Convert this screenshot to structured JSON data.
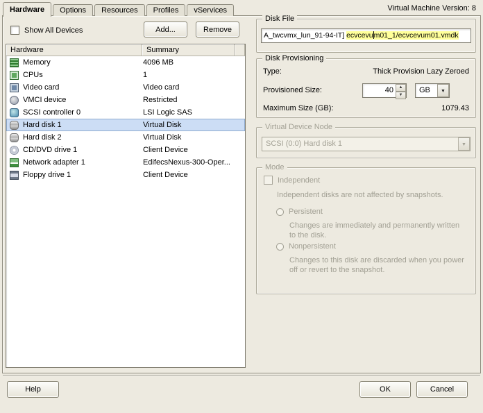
{
  "window": {
    "version_label": "Virtual Machine Version: 8"
  },
  "tabs": [
    {
      "label": "Hardware",
      "active": true
    },
    {
      "label": "Options"
    },
    {
      "label": "Resources"
    },
    {
      "label": "Profiles"
    },
    {
      "label": "vServices"
    }
  ],
  "left_panel": {
    "show_all_devices_label": "Show All Devices",
    "show_all_devices_checked": false,
    "add_button": "Add...",
    "remove_button": "Remove",
    "table": {
      "headers": [
        "Hardware",
        "Summary"
      ],
      "rows": [
        {
          "icon": "memory-icon",
          "hardware": "Memory",
          "summary": "4096 MB"
        },
        {
          "icon": "cpu-icon",
          "hardware": "CPUs",
          "summary": "1"
        },
        {
          "icon": "video-card-icon",
          "hardware": "Video card",
          "summary": "Video card"
        },
        {
          "icon": "vmci-device-icon",
          "hardware": "VMCI device",
          "summary": "Restricted"
        },
        {
          "icon": "scsi-controller-icon",
          "hardware": "SCSI controller 0",
          "summary": "LSI Logic SAS"
        },
        {
          "icon": "hard-disk-icon",
          "hardware": "Hard disk 1",
          "summary": "Virtual Disk",
          "selected": true
        },
        {
          "icon": "hard-disk-icon",
          "hardware": "Hard disk 2",
          "summary": "Virtual Disk"
        },
        {
          "icon": "cd-dvd-drive-icon",
          "hardware": "CD/DVD drive 1",
          "summary": "Client Device"
        },
        {
          "icon": "network-adapter-icon",
          "hardware": "Network adapter 1",
          "summary": "EdifecsNexus-300-Oper..."
        },
        {
          "icon": "floppy-drive-icon",
          "hardware": "Floppy drive 1",
          "summary": "Client Device"
        }
      ]
    }
  },
  "disk_file": {
    "group_label": "Disk File",
    "path_prefix": "A_twcvmx_lun_91-94-IT] ",
    "path_highlight_a": "ecvcevu",
    "path_highlight_b": "m01_1/ecvcevum01.vmdk",
    "highlight_color": "#FFFF99"
  },
  "disk_provisioning": {
    "group_label": "Disk Provisioning",
    "type_label": "Type:",
    "type_value": "Thick Provision Lazy Zeroed",
    "provisioned_size_label": "Provisioned Size:",
    "provisioned_size_value": "40",
    "size_unit": "GB",
    "maximum_size_label": "Maximum Size (GB):",
    "maximum_size_value": "1079.43"
  },
  "virtual_device_node": {
    "group_label": "Virtual Device Node",
    "selected_value": "SCSI (0:0) Hard disk 1"
  },
  "mode": {
    "group_label": "Mode",
    "independent_label": "Independent",
    "independent_description": "Independent disks are not affected by snapshots.",
    "persistent_label": "Persistent",
    "persistent_description": "Changes are immediately and permanently written to the disk.",
    "nonpersistent_label": "Nonpersistent",
    "nonpersistent_description": "Changes to this disk are discarded when you power off or revert to the snapshot."
  },
  "footer": {
    "help_button": "Help",
    "ok_button": "OK",
    "cancel_button": "Cancel"
  }
}
